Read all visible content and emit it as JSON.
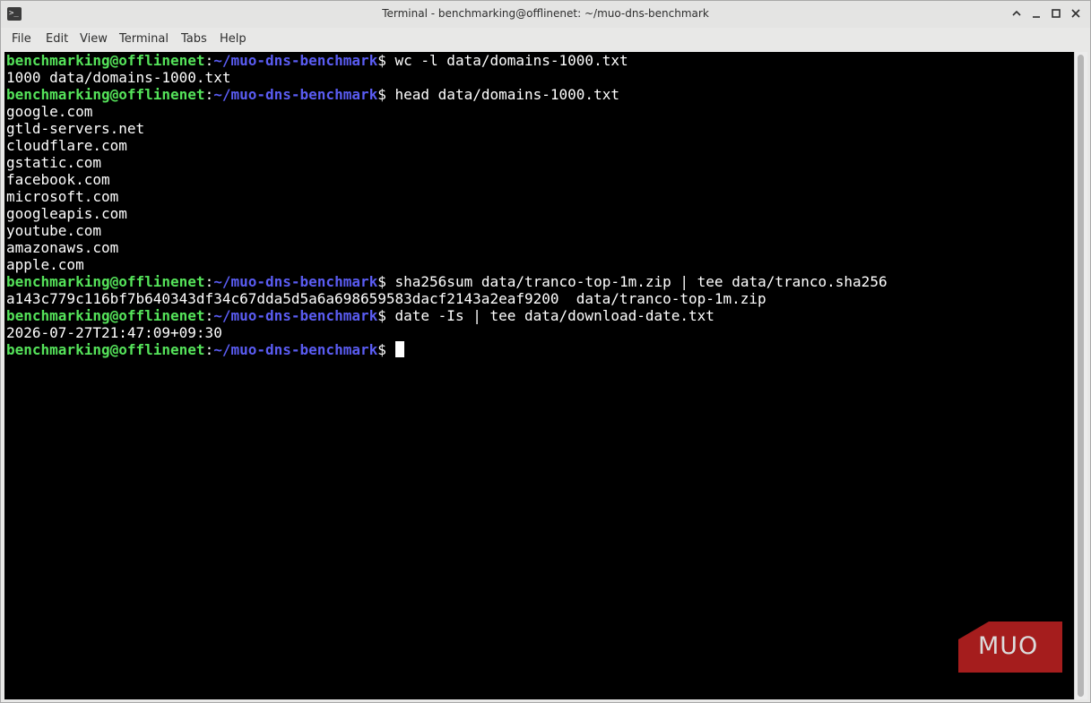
{
  "window": {
    "title": "Terminal - benchmarking@offlinenet: ~/muo-dns-benchmark"
  },
  "menubar": {
    "items": [
      "File",
      "Edit",
      "View",
      "Terminal",
      "Tabs",
      "Help"
    ]
  },
  "prompt": {
    "user_host": "benchmarking@offlinenet",
    "separator": ":",
    "path": "~/muo-dns-benchmark",
    "symbol": "$"
  },
  "lines": [
    {
      "type": "prompt",
      "command": " wc -l data/domains-1000.txt"
    },
    {
      "type": "output",
      "text": "1000 data/domains-1000.txt"
    },
    {
      "type": "prompt",
      "command": " head data/domains-1000.txt"
    },
    {
      "type": "output",
      "text": "google.com"
    },
    {
      "type": "output",
      "text": "gtld-servers.net"
    },
    {
      "type": "output",
      "text": "cloudflare.com"
    },
    {
      "type": "output",
      "text": "gstatic.com"
    },
    {
      "type": "output",
      "text": "facebook.com"
    },
    {
      "type": "output",
      "text": "microsoft.com"
    },
    {
      "type": "output",
      "text": "googleapis.com"
    },
    {
      "type": "output",
      "text": "youtube.com"
    },
    {
      "type": "output",
      "text": "amazonaws.com"
    },
    {
      "type": "output",
      "text": "apple.com"
    },
    {
      "type": "prompt",
      "command": " sha256sum data/tranco-top-1m.zip | tee data/tranco.sha256"
    },
    {
      "type": "output",
      "text": "a143c779c116bf7b640343df34c67dda5d5a6a698659583dacf2143a2eaf9200  data/tranco-top-1m.zip"
    },
    {
      "type": "prompt",
      "command": " date -Is | tee data/download-date.txt"
    },
    {
      "type": "output",
      "text": "2026-07-27T21:47:09+09:30"
    },
    {
      "type": "prompt",
      "command": " ",
      "cursor": true
    }
  ],
  "watermark": {
    "text": "MUO",
    "color": "#a51d1d"
  },
  "colors": {
    "user_host": "#55e35a",
    "path": "#5a5cf2",
    "text": "#ffffff",
    "background": "#000000"
  },
  "icons": [
    "terminal-app-icon",
    "chevron-up-icon",
    "minimize-icon",
    "maximize-icon",
    "close-icon"
  ]
}
